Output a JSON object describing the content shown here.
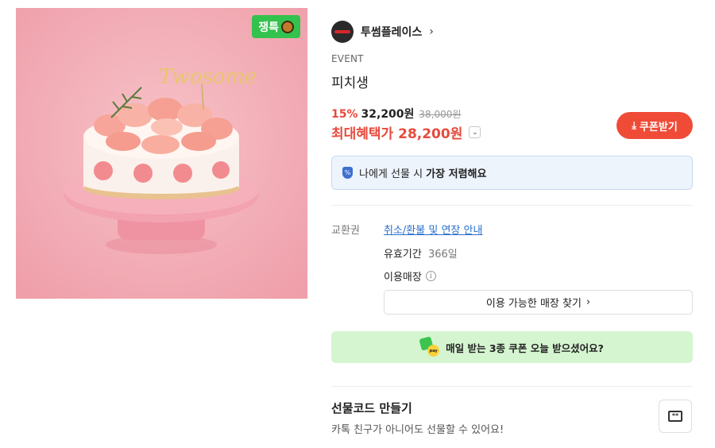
{
  "product_image": {
    "alt": "",
    "topper_text": "Twosome",
    "badge": {
      "label": "쟁특",
      "icon": "acorn-icon"
    }
  },
  "brand": {
    "name": "투썸플레이스",
    "chevron": "›"
  },
  "product": {
    "eyebrow": "EVENT",
    "title": "피치생"
  },
  "pricing": {
    "discount": "15%",
    "price": "32,200원",
    "original": "38,000원",
    "max_benefit": "최대혜택가 28,200원",
    "toggle_glyph": "⌄"
  },
  "coupon_button": {
    "icon": "download-icon",
    "label": "쿠폰받기"
  },
  "notice": {
    "text_before": "나에게 선물 시",
    "text_bold": "가장 저렴해요"
  },
  "details": {
    "exchange_label": "교환권",
    "refund_link": "취소/환불 및 연장 안내",
    "validity_label": "유효기간",
    "validity_value": "366일",
    "stores_label": "이용매장",
    "find_store_label": "이용 가능한 매장 찾기",
    "find_store_chevron": "›"
  },
  "promo": {
    "text": "매일 받는 3종 쿠폰 오늘 받으셨어요?",
    "coin_text": "pay"
  },
  "gift_code": {
    "title": "선물코드 만들기",
    "subtitle": "카톡 친구가 아니어도 선물할 수 있어요!",
    "icon_glyph": "**"
  },
  "colors": {
    "accent_red": "#ef4b37",
    "link_blue": "#2a6fcf",
    "promo_green": "#d5f5d0",
    "badge_green": "#33c24d"
  }
}
